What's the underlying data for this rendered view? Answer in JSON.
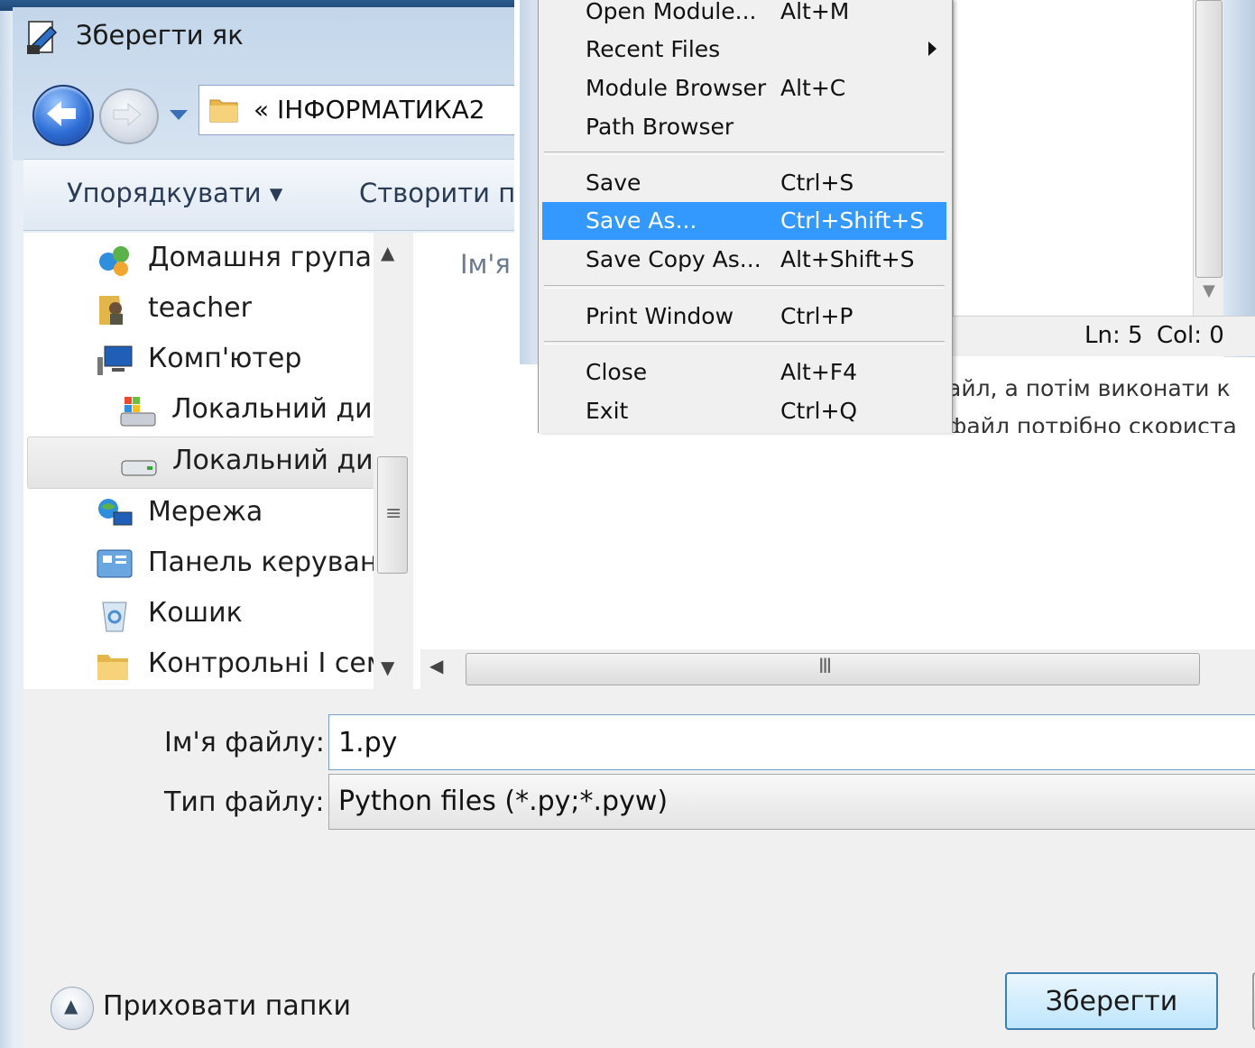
{
  "dialog": {
    "title": "Зберегти як",
    "address": "« ІНФОРМАТИКА2",
    "toolbar": {
      "organize": "Упорядкувати ▾",
      "new_folder": "Створити па"
    },
    "nav_items": [
      {
        "label": "Домашня група",
        "icon": "homegroup-icon"
      },
      {
        "label": "teacher",
        "icon": "user-folder-icon"
      },
      {
        "label": "Комп'ютер",
        "icon": "computer-icon"
      },
      {
        "label": "Локальний дис",
        "icon": "system-drive-icon"
      },
      {
        "label": "Локальний дис",
        "icon": "drive-icon"
      },
      {
        "label": "Мережа",
        "icon": "network-icon"
      },
      {
        "label": "Панель керуванн",
        "icon": "control-panel-icon"
      },
      {
        "label": "Кошик",
        "icon": "recycle-bin-icon"
      },
      {
        "label": "Контрольні І сем",
        "icon": "folder-icon"
      }
    ],
    "column_header": "Ім'я",
    "filename_label": "Ім'я файлу:",
    "filename_value": "1.py",
    "filetype_label": "Тип файлу:",
    "filetype_value": "Python files (*.py;*.pyw)",
    "hide_folders": "Приховати папки",
    "save_button": "Зберегти"
  },
  "menu": {
    "items": [
      {
        "label": "Open Module...",
        "shortcut": "Alt+M"
      },
      {
        "label": "Recent Files",
        "shortcut": ""
      },
      {
        "label": "Module Browser",
        "shortcut": "Alt+C"
      },
      {
        "label": "Path Browser",
        "shortcut": ""
      },
      {
        "label": "Save",
        "shortcut": "Ctrl+S"
      },
      {
        "label": "Save As...",
        "shortcut": "Ctrl+Shift+S"
      },
      {
        "label": "Save Copy As...",
        "shortcut": "Alt+Shift+S"
      },
      {
        "label": "Print Window",
        "shortcut": "Ctrl+P"
      },
      {
        "label": "Close",
        "shortcut": "Alt+F4"
      },
      {
        "label": "Exit",
        "shortcut": "Ctrl+Q"
      }
    ],
    "selected": "Save As..."
  },
  "idle_status": {
    "ln": "Ln: 5",
    "col": "Col: 0"
  },
  "background_text": {
    "line1": "айл, а потім виконати к",
    "line2": "файл потрібно скориста"
  },
  "colors": {
    "menu_highlight": "#3399ff",
    "save_border": "#3c7fb1"
  }
}
